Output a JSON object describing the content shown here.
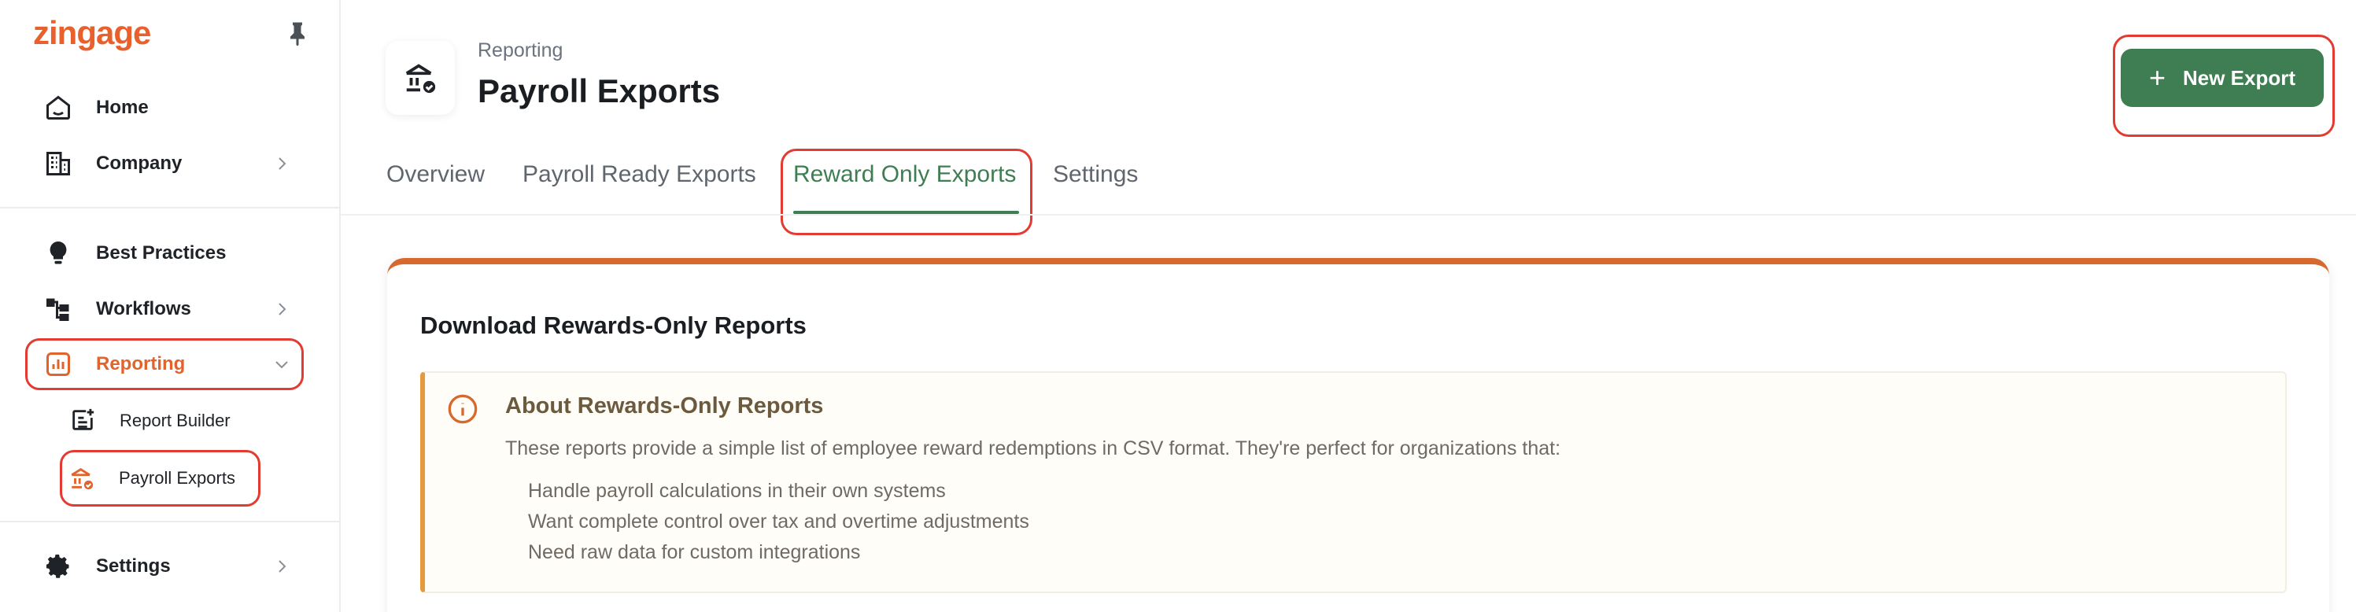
{
  "sidebar": {
    "logo": "zingage",
    "items": [
      {
        "label": "Home",
        "icon": "home-icon"
      },
      {
        "label": "Company",
        "icon": "building-icon"
      },
      {
        "label": "Best Practices",
        "icon": "lightbulb-icon"
      },
      {
        "label": "Workflows",
        "icon": "workflow-icon"
      },
      {
        "label": "Reporting",
        "icon": "chart-icon"
      },
      {
        "label": "Settings",
        "icon": "gear-icon"
      }
    ],
    "subitems": [
      {
        "label": "Report Builder",
        "icon": "report-builder-icon"
      },
      {
        "label": "Payroll Exports",
        "icon": "bank-check-icon"
      }
    ]
  },
  "header": {
    "breadcrumb": "Reporting",
    "title": "Payroll Exports",
    "new_export_label": "New Export"
  },
  "tabs": [
    {
      "label": "Overview"
    },
    {
      "label": "Payroll Ready Exports"
    },
    {
      "label": "Reward Only Exports"
    },
    {
      "label": "Settings"
    }
  ],
  "card": {
    "title": "Download Rewards-Only Reports",
    "info": {
      "title": "About Rewards-Only Reports",
      "description": "These reports provide a simple list of employee reward redemptions in CSV format. They're perfect for organizations that:",
      "items": [
        "Handle payroll calculations in their own systems",
        "Want complete control over tax and overtime adjustments",
        "Need raw data for custom integrations"
      ]
    }
  },
  "colors": {
    "brand": "#e8612c",
    "accent_green": "#3f7d52",
    "highlight_red": "#e23b32",
    "card_top": "#d66a2e",
    "info_border": "#e59a3e"
  }
}
